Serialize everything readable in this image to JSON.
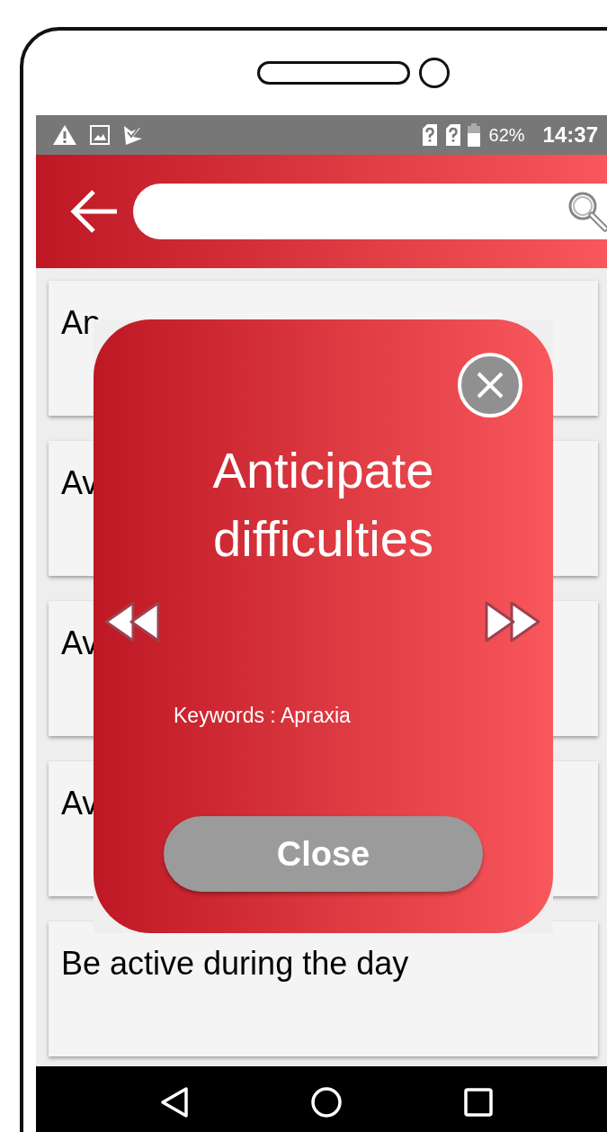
{
  "status_bar": {
    "battery": "62%",
    "time": "14:37"
  },
  "list": {
    "items": [
      {
        "text": "An"
      },
      {
        "text": "Av"
      },
      {
        "text": "Av"
      },
      {
        "text": "Av"
      },
      {
        "text": "Be active during the day"
      }
    ]
  },
  "dialog": {
    "title": "Anticipate difficulties",
    "keywords": "Keywords : Apraxia",
    "close_button": "Close"
  }
}
